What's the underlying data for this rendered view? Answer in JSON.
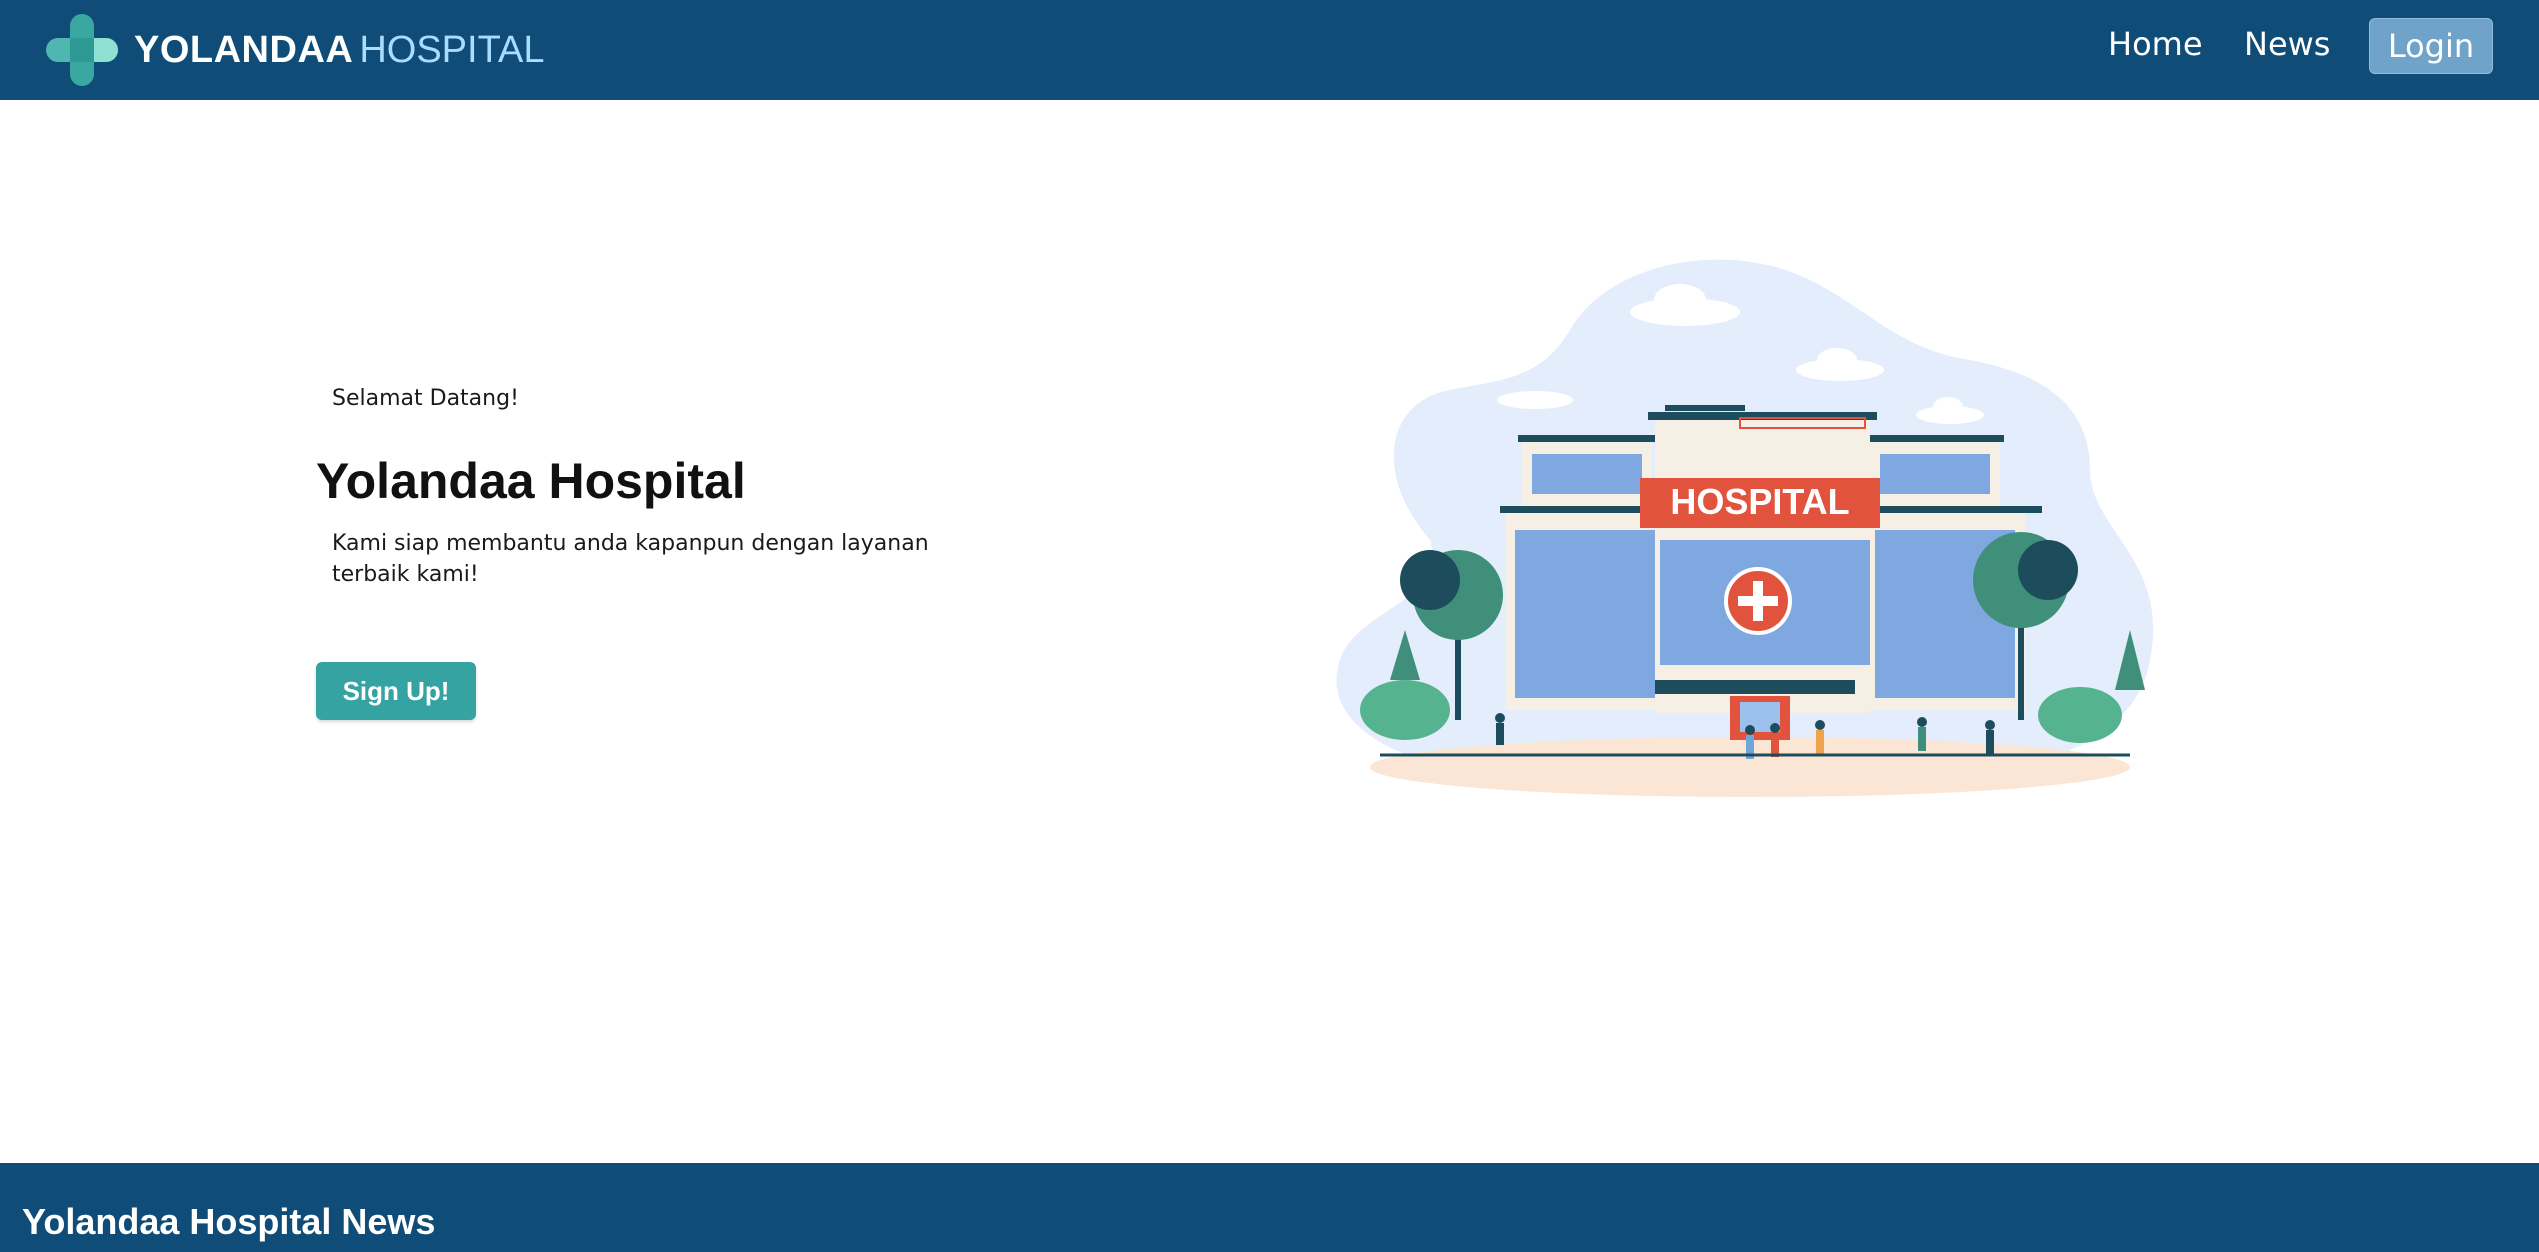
{
  "navbar": {
    "brand_bold": "YOLANDAA",
    "brand_light": "HOSPITAL",
    "logo_icon": "medical-cross-icon",
    "links": [
      {
        "label": "Home"
      },
      {
        "label": "News"
      }
    ],
    "login_label": "Login"
  },
  "hero": {
    "greeting": "Selamat Datang!",
    "title": "Yolandaa Hospital",
    "description": "Kami siap membantu anda kapanpun dengan layanan terbaik kami!",
    "signup_label": "Sign Up!",
    "illustration": {
      "sign_text": "HOSPITAL",
      "icon": "hospital-building-illustration"
    }
  },
  "footer": {
    "title": "Yolandaa Hospital News"
  },
  "colors": {
    "navbar_bg": "#0f4d78",
    "brand_accent": "#a9dcff",
    "login_bg": "#6fa3ca",
    "signup_bg": "#35a3a2",
    "hospital_red": "#e2533d"
  }
}
